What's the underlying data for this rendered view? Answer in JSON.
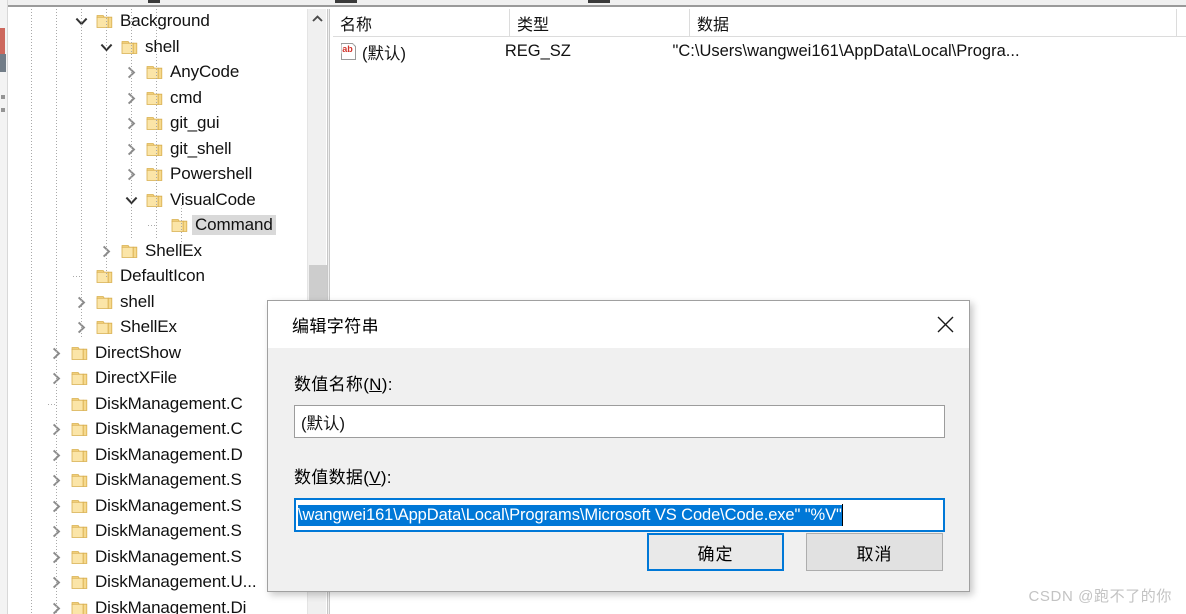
{
  "app": {
    "name": "registry-editor",
    "accent_color": "#0078d7",
    "selection_gray": "#d9d9d9"
  },
  "tree": {
    "scrollbar": {
      "up_arrow_icon": "chevron-up-icon",
      "thumb_position_pct": 42
    },
    "items": [
      {
        "label": "Background",
        "depth": 1,
        "expander": "expanded",
        "selected": false
      },
      {
        "label": "shell",
        "depth": 2,
        "expander": "expanded",
        "selected": false
      },
      {
        "label": "AnyCode",
        "depth": 3,
        "expander": "collapsed",
        "selected": false
      },
      {
        "label": "cmd",
        "depth": 3,
        "expander": "collapsed",
        "selected": false
      },
      {
        "label": "git_gui",
        "depth": 3,
        "expander": "collapsed",
        "selected": false
      },
      {
        "label": "git_shell",
        "depth": 3,
        "expander": "collapsed",
        "selected": false
      },
      {
        "label": "Powershell",
        "depth": 3,
        "expander": "collapsed",
        "selected": false
      },
      {
        "label": "VisualCode",
        "depth": 3,
        "expander": "expanded",
        "selected": false
      },
      {
        "label": "Command",
        "depth": 4,
        "expander": "none",
        "selected": true
      },
      {
        "label": "ShellEx",
        "depth": 2,
        "expander": "collapsed",
        "selected": false
      },
      {
        "label": "DefaultIcon",
        "depth": 1,
        "expander": "none",
        "selected": false
      },
      {
        "label": "shell",
        "depth": 1,
        "expander": "collapsed",
        "selected": false
      },
      {
        "label": "ShellEx",
        "depth": 1,
        "expander": "collapsed",
        "selected": false
      },
      {
        "label": "DirectShow",
        "depth": 0,
        "expander": "collapsed",
        "selected": false
      },
      {
        "label": "DirectXFile",
        "depth": 0,
        "expander": "collapsed",
        "selected": false
      },
      {
        "label": "DiskManagement.C",
        "depth": 0,
        "expander": "none",
        "selected": false
      },
      {
        "label": "DiskManagement.C",
        "depth": 0,
        "expander": "collapsed",
        "selected": false
      },
      {
        "label": "DiskManagement.D",
        "depth": 0,
        "expander": "collapsed",
        "selected": false
      },
      {
        "label": "DiskManagement.S",
        "depth": 0,
        "expander": "collapsed",
        "selected": false
      },
      {
        "label": "DiskManagement.S",
        "depth": 0,
        "expander": "collapsed",
        "selected": false
      },
      {
        "label": "DiskManagement.S",
        "depth": 0,
        "expander": "collapsed",
        "selected": false
      },
      {
        "label": "DiskManagement.S",
        "depth": 0,
        "expander": "collapsed",
        "selected": false
      },
      {
        "label": "DiskManagement.U...",
        "depth": 0,
        "expander": "collapsed",
        "selected": false
      },
      {
        "label": "DiskManagement.Di",
        "depth": 0,
        "expander": "collapsed",
        "selected": false
      }
    ]
  },
  "value_list": {
    "columns": [
      "名称",
      "类型",
      "数据"
    ],
    "rows": [
      {
        "icon": "regsz-ab-icon",
        "name": "(默认)",
        "type": "REG_SZ",
        "data": "\"C:\\Users\\wangwei161\\AppData\\Local\\Progra..."
      }
    ]
  },
  "dialog": {
    "title": "编辑字符串",
    "close_icon": "close-icon",
    "value_name_label_prefix": "数值名称(",
    "value_name_label_accel": "N",
    "value_name_label_suffix": "):",
    "value_name": "(默认)",
    "value_data_label_prefix": "数值数据(",
    "value_data_label_accel": "V",
    "value_data_label_suffix": "):",
    "value_data": "\\wangwei161\\AppData\\Local\\Programs\\Microsoft VS Code\\Code.exe\" \"%V\"",
    "value_data_selected": true,
    "ok_label": "确定",
    "cancel_label": "取消"
  },
  "watermark": {
    "text": "CSDN @跑不了的你"
  }
}
